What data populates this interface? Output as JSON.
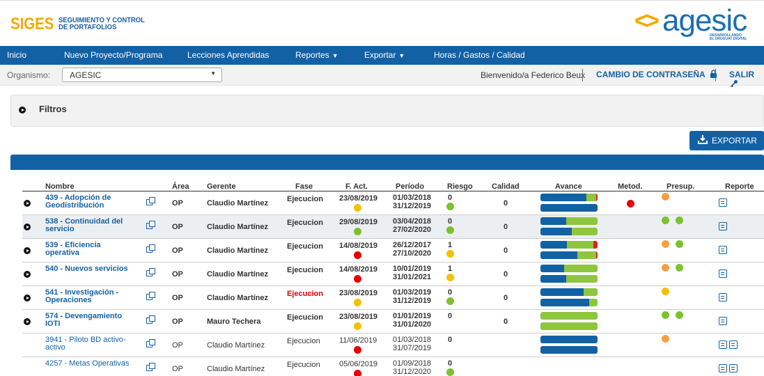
{
  "header": {
    "app_name": "SIGES",
    "app_subtitle_line1": "SEGUIMIENTO Y CONTROL",
    "app_subtitle_line2": "DE PORTAFOLIOS",
    "brand_mark": "<>",
    "brand_word": "agesic",
    "brand_tag_line1": "DESARROLLANDO",
    "brand_tag_line2": "EL URUGUAY DIGITAL"
  },
  "nav": {
    "items": [
      {
        "label": "Inicio"
      },
      {
        "label": "Nuevo Proyecto/Programa"
      },
      {
        "label": "Lecciones Aprendidas"
      },
      {
        "label": "Reportes",
        "dropdown": true
      },
      {
        "label": "Exportar",
        "dropdown": true
      },
      {
        "label": "Horas / Gastos / Calidad"
      }
    ]
  },
  "subbar": {
    "org_label": "Organismo:",
    "org_value": "AGESIC",
    "welcome": "Bienvenido/a Federico Beux",
    "change_password": "CAMBIO DE CONTRASEÑA",
    "logout": "SALIR"
  },
  "filters": {
    "title": "Filtros"
  },
  "export_button": {
    "label": "EXPORTAR"
  },
  "colors": {
    "primary": "#1361a5",
    "accent": "#f5a800",
    "green": "#7cc12f",
    "yellow": "#f5c000",
    "orange": "#f5a040",
    "red": "#e60000"
  },
  "table": {
    "headers": {
      "nombre": "Nombre",
      "area": "Área",
      "gerente": "Gerente",
      "fase": "Fase",
      "fact": "F. Act.",
      "periodo": "Período",
      "riesgo": "Riesgo",
      "calidad": "Calidad",
      "avance": "Avance",
      "metod": "Metod.",
      "presup": "Presup.",
      "reporte": "Reporte"
    },
    "rows": [
      {
        "expandable": true,
        "bold": true,
        "shaded": false,
        "name": "439 - Adopción de Geodistribución",
        "area": "OP",
        "gerente": "Claudio Martínez",
        "fase": "Ejecucion",
        "fase_alert": false,
        "fact": "23/08/2019",
        "fact_status": "yellow",
        "periodo_start": "01/03/2018",
        "periodo_end": "31/12/2019",
        "riesgo": "0",
        "riesgo_status": "green",
        "calidad": "0",
        "avance_bar1": [
          0.8,
          0.18,
          0.02
        ],
        "avance_bar2": [
          1.0,
          0,
          0
        ],
        "metod": "red",
        "presup": [
          "orange"
        ],
        "reportes": 1
      },
      {
        "expandable": true,
        "bold": true,
        "shaded": true,
        "name": "538 - Continuidad del servicio",
        "area": "OP",
        "gerente": "Claudio Martínez",
        "fase": "Ejecucion",
        "fase_alert": false,
        "fact": "29/08/2019",
        "fact_status": "green",
        "periodo_start": "03/04/2018",
        "periodo_end": "27/02/2020",
        "riesgo": "0",
        "riesgo_status": "green",
        "calidad": "0",
        "avance_bar1": [
          0.45,
          0.55,
          0
        ],
        "avance_bar2": [
          0.55,
          0.45,
          0
        ],
        "metod": "",
        "presup": [
          "green",
          "green"
        ],
        "reportes": 1
      },
      {
        "expandable": true,
        "bold": true,
        "shaded": false,
        "name": "539 - Eficiencia operativa",
        "area": "OP",
        "gerente": "Claudio Martínez",
        "fase": "Ejecucion",
        "fase_alert": false,
        "fact": "14/08/2019",
        "fact_status": "red",
        "periodo_start": "26/12/2017",
        "periodo_end": "27/10/2020",
        "riesgo": "1",
        "riesgo_status": "yellow",
        "calidad": "0",
        "avance_bar1": [
          0.46,
          0.47,
          0.07
        ],
        "avance_bar2": [
          0.65,
          0.33,
          0.02
        ],
        "metod": "",
        "presup": [
          "orange",
          "green"
        ],
        "reportes": 1
      },
      {
        "expandable": true,
        "bold": true,
        "shaded": false,
        "name": "540 - Nuevos servicios",
        "area": "OP",
        "gerente": "Claudio Martínez",
        "fase": "Ejecucion",
        "fase_alert": false,
        "fact": "14/08/2019",
        "fact_status": "red",
        "periodo_start": "10/01/2019",
        "periodo_end": "31/01/2021",
        "riesgo": "1",
        "riesgo_status": "yellow",
        "calidad": "0",
        "avance_bar1": [
          0.42,
          0.58,
          0
        ],
        "avance_bar2": [
          0.45,
          0.55,
          0
        ],
        "metod": "",
        "presup": [
          "orange",
          "green"
        ],
        "reportes": 1
      },
      {
        "expandable": true,
        "bold": true,
        "shaded": false,
        "name": "541 - Investigación - Operaciones",
        "area": "OP",
        "gerente": "Claudio Martínez",
        "fase": "Ejecucion",
        "fase_alert": true,
        "fact": "23/08/2019",
        "fact_status": "yellow",
        "periodo_start": "01/03/2019",
        "periodo_end": "31/12/2019",
        "riesgo": "0",
        "riesgo_status": "green",
        "calidad": "0",
        "avance_bar1": [
          0.75,
          0.25,
          0
        ],
        "avance_bar2": [
          0.85,
          0.15,
          0
        ],
        "metod": "",
        "presup": [
          "yellow"
        ],
        "reportes": 1
      },
      {
        "expandable": true,
        "bold": true,
        "shaded": false,
        "name": "574 - Devengamiento IOTI",
        "area": "OP",
        "gerente": "Mauro Techera",
        "fase": "Ejecucion",
        "fase_alert": false,
        "fact": "23/08/2019",
        "fact_status": "yellow",
        "periodo_start": "01/01/2019",
        "periodo_end": "31/01/2020",
        "riesgo": "0",
        "riesgo_status": "",
        "calidad": "0",
        "avance_bar1": [
          0,
          1.0,
          0
        ],
        "avance_bar2": [
          0,
          1.0,
          0
        ],
        "metod": "",
        "presup": [
          "green",
          "green"
        ],
        "reportes": 1
      },
      {
        "expandable": false,
        "bold": false,
        "shaded": false,
        "name": "3941 - Piloto BD activo-activo",
        "area": "OP",
        "gerente": "Claudio Martínez",
        "fase": "Ejecucion",
        "fase_alert": false,
        "fact": "11/06/2019",
        "fact_status": "red",
        "periodo_start": "01/03/2018",
        "periodo_end": "31/07/2019",
        "riesgo": "0",
        "riesgo_status": "",
        "calidad": "",
        "avance_bar1": [
          1.0,
          0,
          0
        ],
        "avance_bar2": [
          1.0,
          0,
          0
        ],
        "metod": "",
        "presup": [
          "orange"
        ],
        "reportes": 2
      },
      {
        "expandable": false,
        "bold": false,
        "shaded": false,
        "name": "4257 - Metas Operativas",
        "area": "OP",
        "gerente": "Claudio Martínez",
        "fase": "Ejecucion",
        "fase_alert": false,
        "fact": "05/06/2019",
        "fact_status": "red",
        "periodo_start": "01/09/2018",
        "periodo_end": "31/12/2020",
        "riesgo": "0",
        "riesgo_status": "green",
        "calidad": "",
        "avance_bar1": [
          0,
          0,
          0
        ],
        "avance_bar2": [
          0,
          0,
          0
        ],
        "metod": "",
        "presup": [],
        "reportes": 2
      }
    ]
  }
}
